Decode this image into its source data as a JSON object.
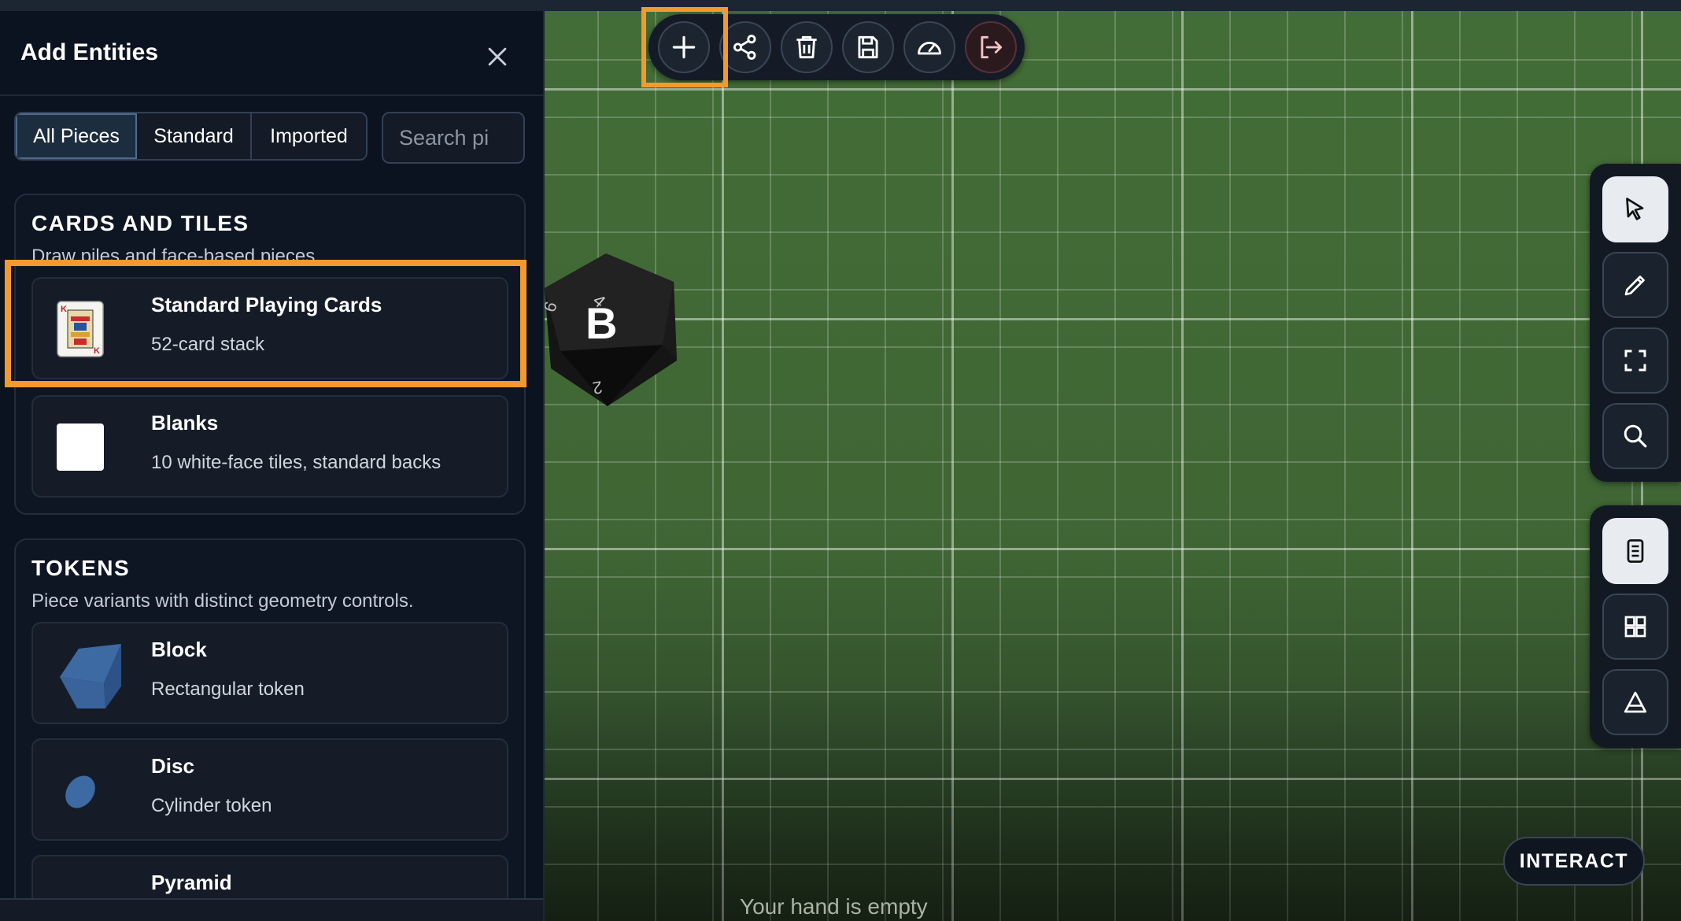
{
  "panel": {
    "title": "Add Entities",
    "tabs": [
      {
        "label": "All Pieces",
        "active": true
      },
      {
        "label": "Standard",
        "active": false
      },
      {
        "label": "Imported",
        "active": false
      }
    ],
    "search": {
      "placeholder": "Search pi"
    },
    "sections": [
      {
        "title": "CARDS AND TILES",
        "description": "Draw piles and face-based pieces.",
        "items": [
          {
            "name": "Standard Playing Cards",
            "description": "52-card stack",
            "icon": "playing-card-king-icon"
          },
          {
            "name": "Blanks",
            "description": "10 white-face tiles, standard backs",
            "icon": "blank-tile-icon"
          }
        ]
      },
      {
        "title": "TOKENS",
        "description": "Piece variants with distinct geometry controls.",
        "items": [
          {
            "name": "Block",
            "description": "Rectangular token",
            "icon": "block-token-icon"
          },
          {
            "name": "Disc",
            "description": "Cylinder token",
            "icon": "disc-token-icon"
          },
          {
            "name": "Pyramid",
            "description": "",
            "icon": ""
          }
        ]
      }
    ]
  },
  "toolbar": {
    "buttons": [
      "add-icon",
      "share-icon",
      "trash-icon",
      "save-icon",
      "speedometer-icon",
      "exit-icon"
    ]
  },
  "board": {
    "die_face_letter": "B",
    "hand_status": "Your hand is empty",
    "interact_label": "INTERACT"
  },
  "right_tools": {
    "top": [
      "pointer-icon",
      "pencil-icon",
      "fullscreen-icon",
      "zoom-icon"
    ],
    "bottom": [
      "document-icon",
      "grid-icon",
      "triangle-icon"
    ]
  },
  "colors": {
    "highlight": "#f29a2e",
    "board_green": "#436d37",
    "panel_bg": "#0b1220"
  }
}
